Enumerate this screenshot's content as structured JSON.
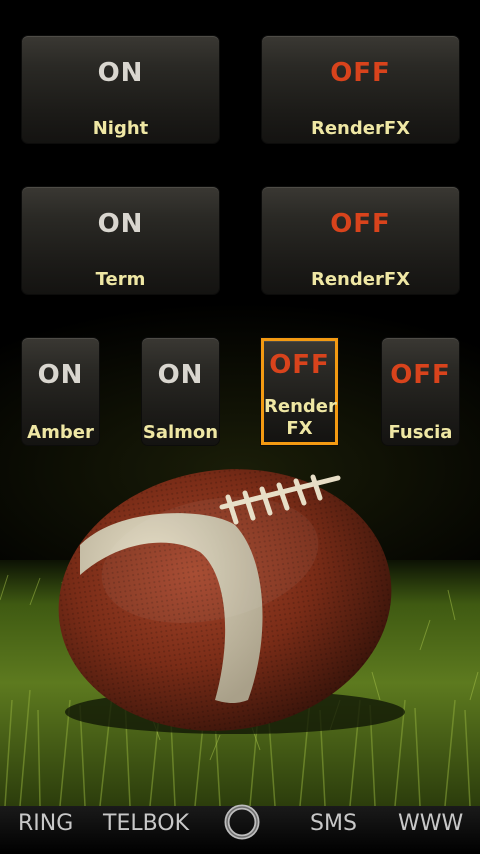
{
  "toggles_large": [
    {
      "state": "ON",
      "label": "Night"
    },
    {
      "state": "OFF",
      "label": "RenderFX"
    },
    {
      "state": "ON",
      "label": "Term"
    },
    {
      "state": "OFF",
      "label": "RenderFX"
    }
  ],
  "toggles_small": [
    {
      "state": "ON",
      "label": "Amber"
    },
    {
      "state": "ON",
      "label": "Salmon"
    },
    {
      "state": "OFF",
      "label": "Render\nFX"
    },
    {
      "state": "OFF",
      "label": "Fuscia"
    }
  ],
  "colors": {
    "on": "#d9d6cf",
    "off": "#d8431c",
    "label": "#efe7a4",
    "selected_border": "#f39a12"
  },
  "bottom_nav": {
    "ring": "RING",
    "telbok": "TELBOK",
    "sms": "SMS",
    "www": "WWW"
  }
}
